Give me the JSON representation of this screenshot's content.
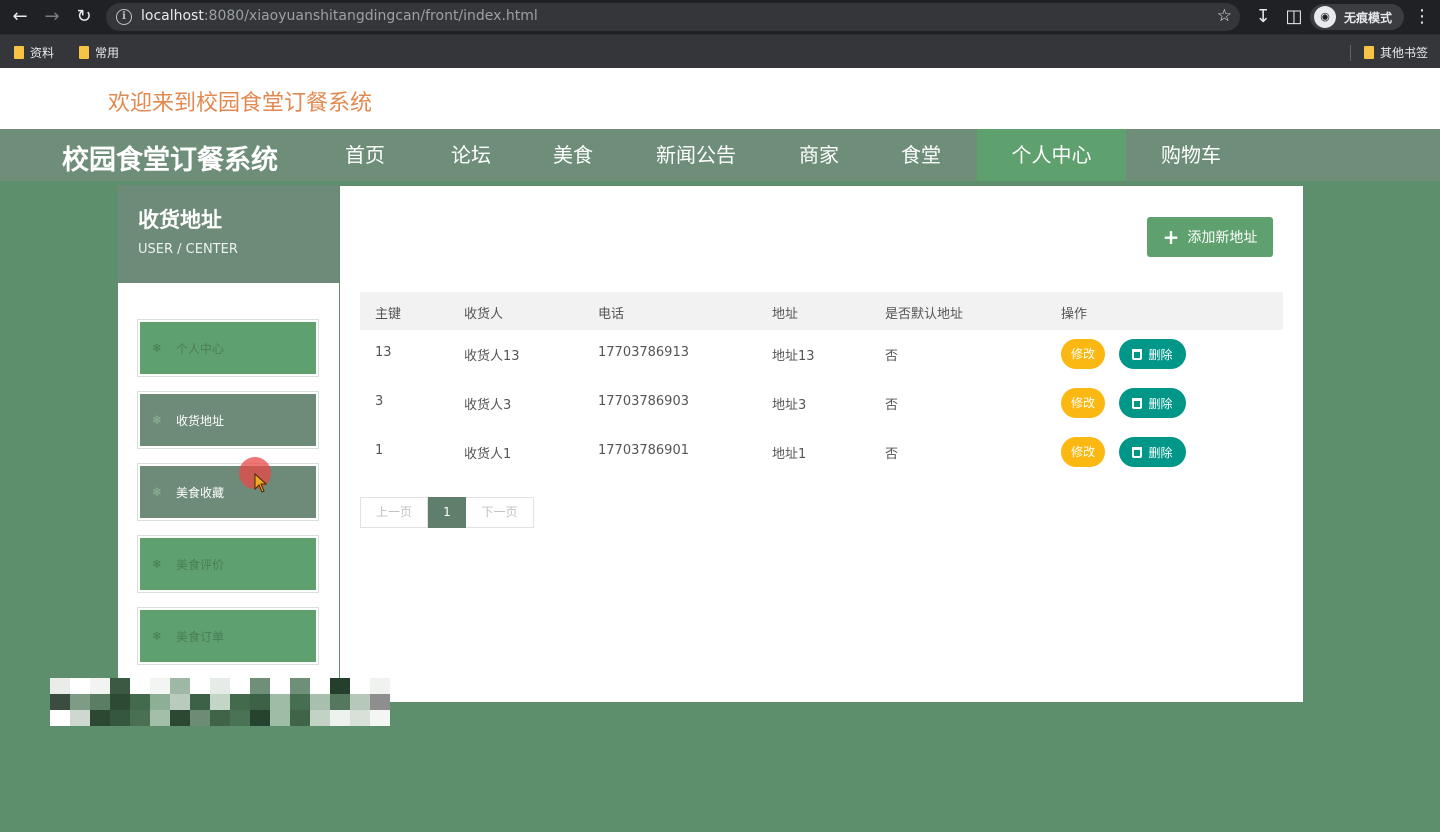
{
  "browser": {
    "url_host": "localhost",
    "url_rest": ":8080/xiaoyuanshitangdingcan/front/index.html",
    "incognito_label": "无痕模式",
    "bookmarks": [
      "资料",
      "常用"
    ],
    "other_bookmarks": "其他书签"
  },
  "header": {
    "welcome": "欢迎来到校园食堂订餐系统",
    "brand": "校园食堂订餐系统",
    "nav": [
      {
        "label": "首页"
      },
      {
        "label": "论坛"
      },
      {
        "label": "美食"
      },
      {
        "label": "新闻公告"
      },
      {
        "label": "商家"
      },
      {
        "label": "食堂"
      },
      {
        "label": "个人中心",
        "active": true
      },
      {
        "label": "购物车"
      }
    ]
  },
  "sidebar": {
    "title": "收货地址",
    "subtitle": "USER / CENTER",
    "items": [
      {
        "label": "个人中心"
      },
      {
        "label": "收货地址",
        "active": true
      },
      {
        "label": "美食收藏",
        "hover": true
      },
      {
        "label": "美食评价"
      },
      {
        "label": "美食订单"
      }
    ]
  },
  "main": {
    "add_label": "添加新地址",
    "columns": [
      "主键",
      "收货人",
      "电话",
      "地址",
      "是否默认地址",
      "操作"
    ],
    "rows": [
      {
        "id": "13",
        "name": "收货人13",
        "phone": "17703786913",
        "address": "地址13",
        "default": "否"
      },
      {
        "id": "3",
        "name": "收货人3",
        "phone": "17703786903",
        "address": "地址3",
        "default": "否"
      },
      {
        "id": "1",
        "name": "收货人1",
        "phone": "17703786901",
        "address": "地址1",
        "default": "否"
      }
    ],
    "edit_label": "修改",
    "delete_label": "删除",
    "pager": {
      "prev": "上一页",
      "current": "1",
      "next": "下一页"
    }
  },
  "colors": {
    "accent": "#5fa16e",
    "nav_bg": "#6e8e79",
    "welcome": "#e2894f",
    "edit": "#fbb812",
    "delete": "#009688"
  }
}
